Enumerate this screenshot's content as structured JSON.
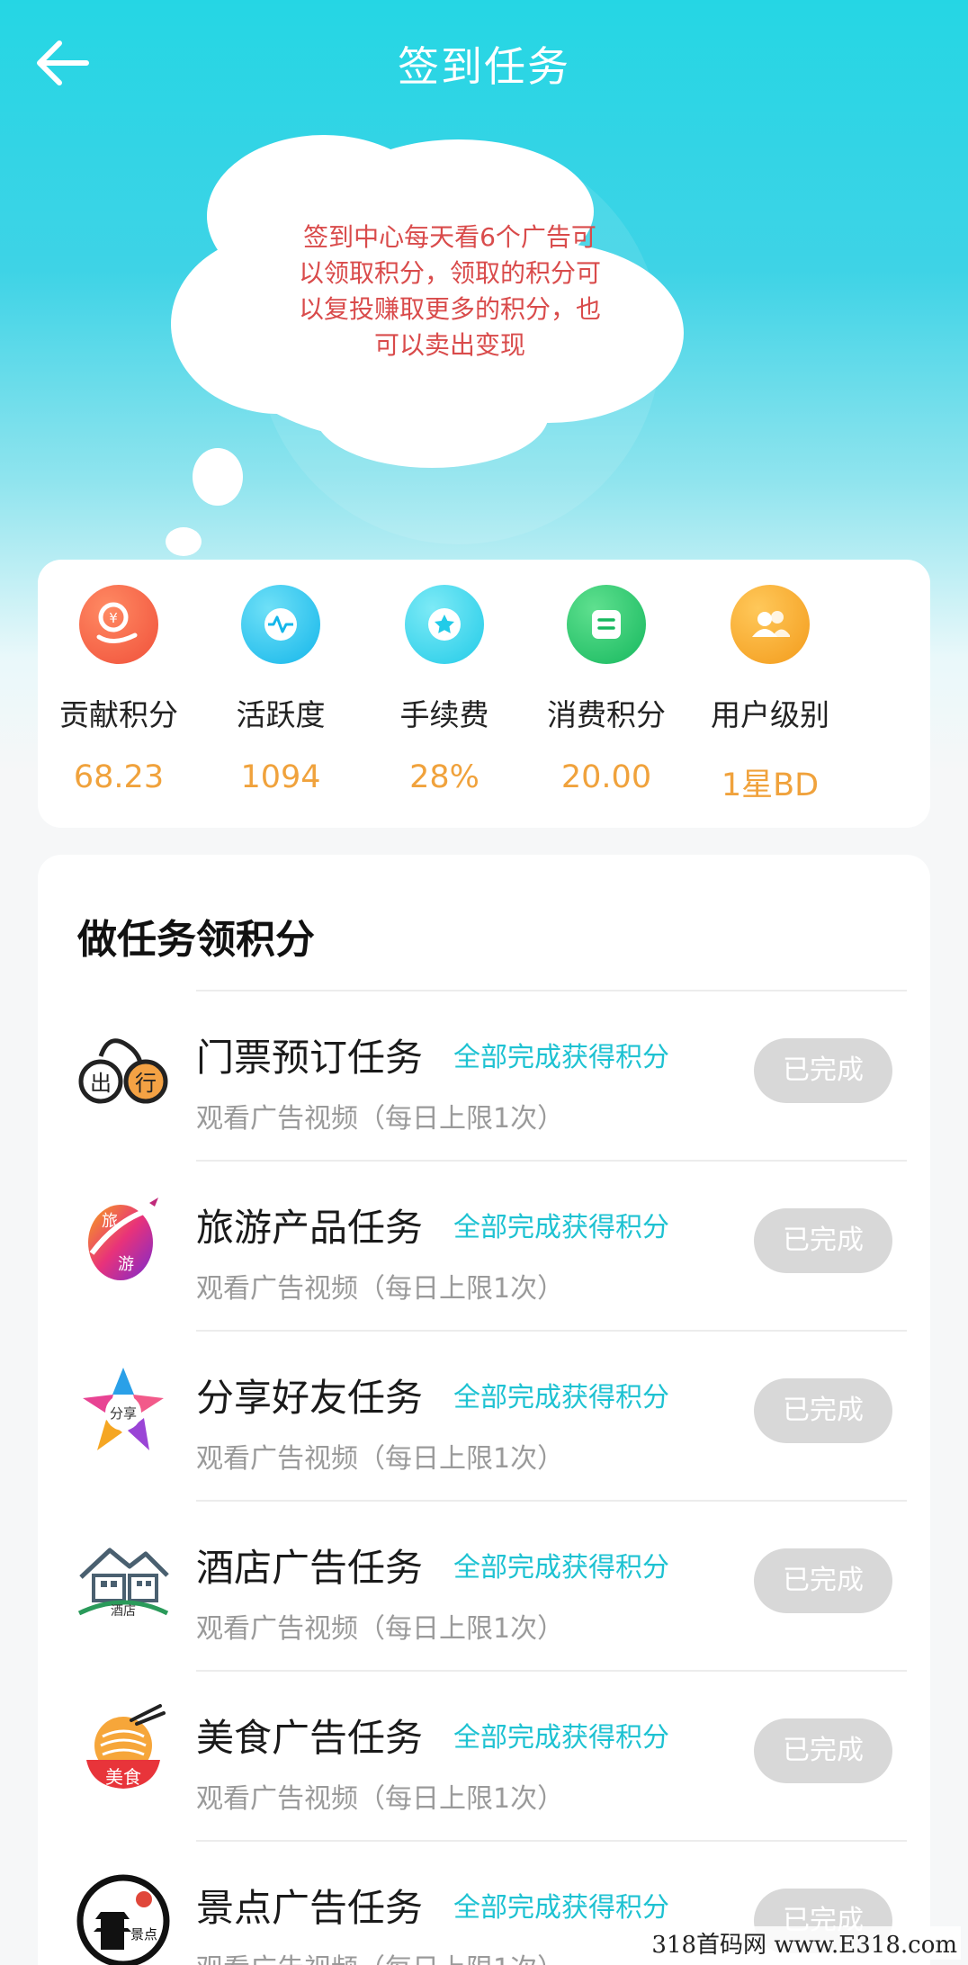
{
  "header": {
    "title": "签到任务"
  },
  "bubble": {
    "text": "签到中心每天看6个广告可以领取积分，领取的积分可以复投赚取更多的积分，也可以卖出变现"
  },
  "stats": [
    {
      "label": "贡献积分",
      "value": "68.23",
      "icon": "contribution-icon",
      "color": "#f2603c"
    },
    {
      "label": "活跃度",
      "value": "1094",
      "icon": "activity-icon",
      "color": "#1fc6ef"
    },
    {
      "label": "手续费",
      "value": "28%",
      "icon": "fee-icon",
      "color": "#2bd0ec"
    },
    {
      "label": "消费积分",
      "value": "20.00",
      "icon": "consume-icon",
      "color": "#22c46a"
    },
    {
      "label": "用户级别",
      "value": "1星BD",
      "icon": "level-icon",
      "color": "#f6a623"
    }
  ],
  "tasks_section": {
    "title": "做任务领积分",
    "items": [
      {
        "name": "门票预订任务",
        "reward": "全部完成获得积分",
        "desc": "观看广告视频（每日上限1次）",
        "status": "已完成",
        "logo": "travel-logo",
        "logo_text_a": "出",
        "logo_text_b": "行"
      },
      {
        "name": "旅游产品任务",
        "reward": "全部完成获得积分",
        "desc": "观看广告视频（每日上限1次）",
        "status": "已完成",
        "logo": "tour-logo",
        "logo_text_a": "旅",
        "logo_text_b": "游"
      },
      {
        "name": "分享好友任务",
        "reward": "全部完成获得积分",
        "desc": "观看广告视频（每日上限1次）",
        "status": "已完成",
        "logo": "share-logo",
        "logo_text_a": "分享",
        "logo_text_b": ""
      },
      {
        "name": "酒店广告任务",
        "reward": "全部完成获得积分",
        "desc": "观看广告视频（每日上限1次）",
        "status": "已完成",
        "logo": "hotel-logo",
        "logo_text_a": "酒店",
        "logo_text_b": ""
      },
      {
        "name": "美食广告任务",
        "reward": "全部完成获得积分",
        "desc": "观看广告视频（每日上限1次）",
        "status": "已完成",
        "logo": "food-logo",
        "logo_text_a": "美食",
        "logo_text_b": ""
      },
      {
        "name": "景点广告任务",
        "reward": "全部完成获得积分",
        "desc": "观看广告视频（每日上限1次）",
        "status": "已完成",
        "logo": "scenic-logo",
        "logo_text_a": "景点",
        "logo_text_b": ""
      }
    ]
  },
  "watermark": "318首码网 www.E318.com"
}
